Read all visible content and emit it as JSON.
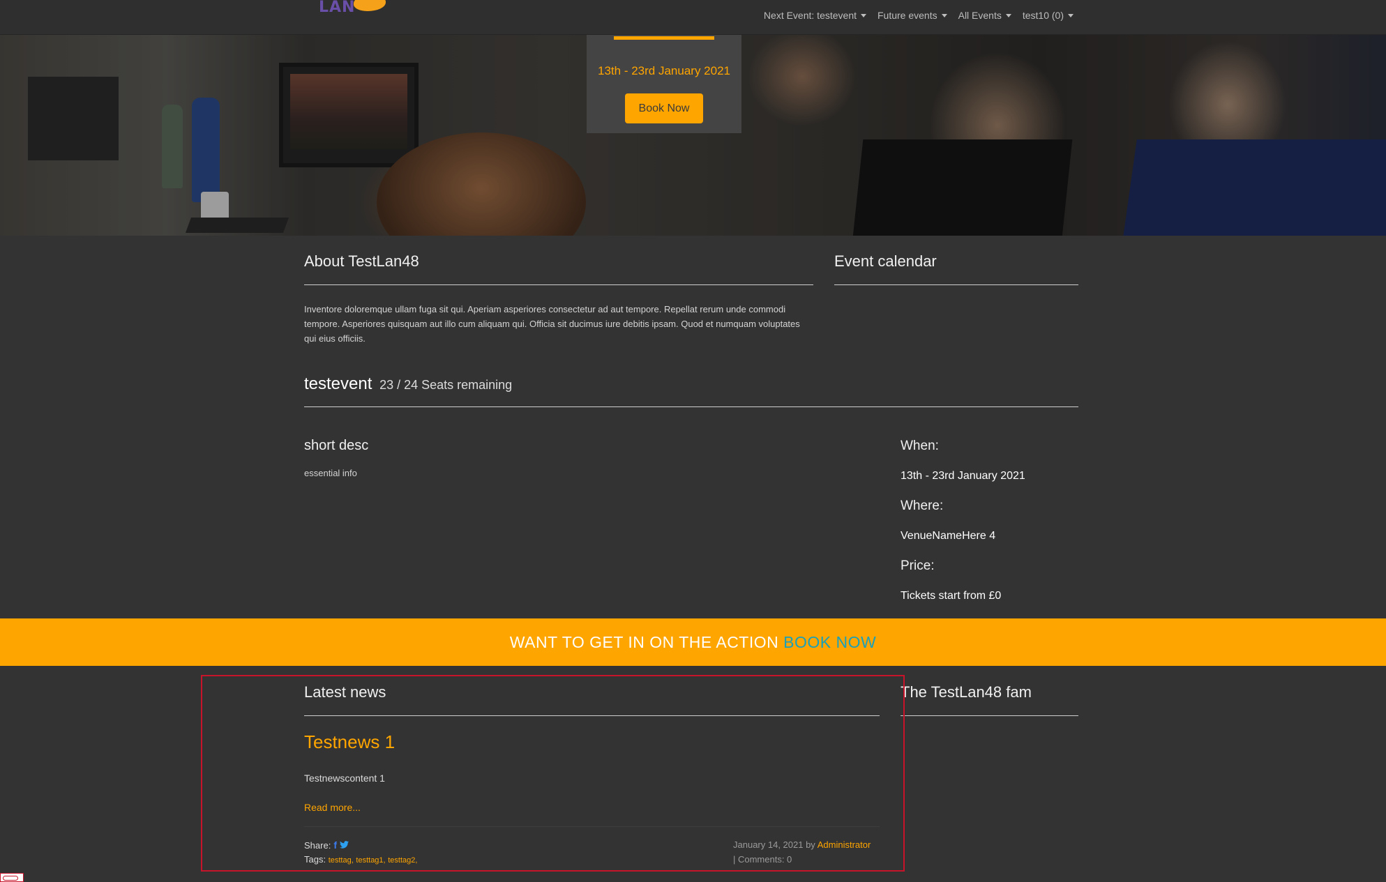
{
  "nav": {
    "logo_text": "LAN",
    "items": [
      {
        "label": "Next Event: testevent"
      },
      {
        "label": "Future events"
      },
      {
        "label": "All Events"
      },
      {
        "label": "test10 (0)"
      }
    ]
  },
  "hero": {
    "event_dates": "13th - 23rd January 2021",
    "book_button": "Book Now"
  },
  "about": {
    "title": "About TestLan48",
    "text": "Inventore doloremque ullam fuga sit qui. Aperiam asperiores consectetur ad aut tempore. Repellat rerum unde commodi tempore. Asperiores quisquam aut illo cum aliquam qui. Officia sit ducimus iure debitis ipsam. Quod et numquam voluptates qui eius officiis."
  },
  "calendar": {
    "title": "Event calendar"
  },
  "event": {
    "name": "testevent",
    "seats": "23 / 24 Seats remaining",
    "short_desc": "short desc",
    "essential_info": "essential info",
    "when_label": "When:",
    "when_value": "13th - 23rd January 2021",
    "where_label": "Where:",
    "where_value": "VenueNameHere 4",
    "price_label": "Price:",
    "price_value": "Tickets start from £0"
  },
  "banner": {
    "text": "WANT TO GET IN ON THE ACTION",
    "cta": "BOOK NOW"
  },
  "news": {
    "section_title": "Latest news",
    "fam_title": "The TestLan48 fam",
    "article": {
      "title": "Testnews 1",
      "content": "Testnewscontent 1",
      "read_more": "Read more...",
      "share_label": "Share:",
      "tags_label": "Tags:",
      "tags": [
        "testtag,",
        "testtag1,",
        "testtag2,"
      ],
      "date_by": "January 14, 2021 by",
      "author": "Administrator",
      "comments": "| Comments: 0"
    }
  },
  "colors": {
    "accent": "#ffa500",
    "background": "#333333",
    "banner_link": "#1aa0b8"
  }
}
